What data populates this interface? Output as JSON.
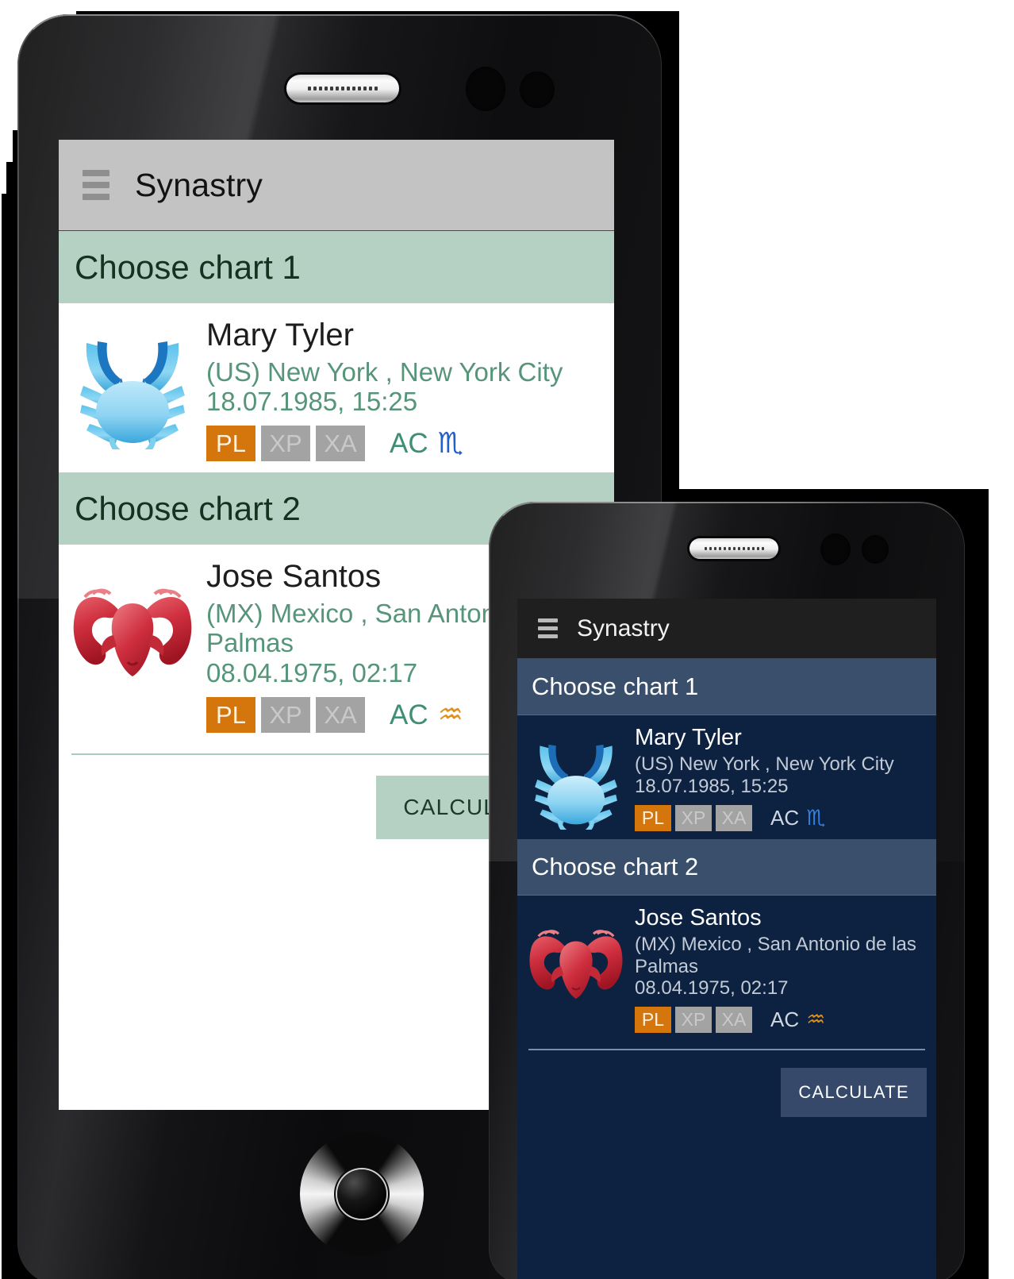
{
  "app": {
    "title": "Synastry",
    "menu_icon": "hamburger-menu-icon"
  },
  "colors": {
    "light_accent": "#b4d1c4",
    "light_appbar": "#c3c3c3",
    "light_sub_text": "#56957a",
    "dark_background": "#0d2240",
    "dark_section": "#3a4f6b",
    "dark_appbar": "#1f1f1f",
    "badge_active": "#d4760b",
    "badge_inactive": "#a3a3a3",
    "scorpio_glyph": "#1f5fd0",
    "aquarius_glyph": "#e09020"
  },
  "sections": {
    "chart1_label": "Choose chart 1",
    "chart2_label": "Choose chart 2"
  },
  "calculate_label": "CALCULATE",
  "entries": [
    {
      "zodiac_icon": "cancer-crab-icon",
      "name": "Mary Tyler",
      "location": "(US) New York  , New York City",
      "datetime": "18.07.1985, 15:25",
      "badges": [
        {
          "label": "PL",
          "state": "on"
        },
        {
          "label": "XP",
          "state": "off"
        },
        {
          "label": "XA",
          "state": "off"
        }
      ],
      "ascendant_label": "AC",
      "ascendant_glyph": "♏",
      "ascendant_glyph_name": "scorpio-glyph"
    },
    {
      "zodiac_icon": "aries-ram-icon",
      "name": "Jose Santos",
      "location": "(MX) Mexico  , San Antonio de las Palmas",
      "datetime": "08.04.1975, 02:17",
      "badges": [
        {
          "label": "PL",
          "state": "on"
        },
        {
          "label": "XP",
          "state": "off"
        },
        {
          "label": "XA",
          "state": "off"
        }
      ],
      "ascendant_label": "AC",
      "ascendant_glyph": "♒",
      "ascendant_glyph_name": "aquarius-glyph"
    }
  ]
}
